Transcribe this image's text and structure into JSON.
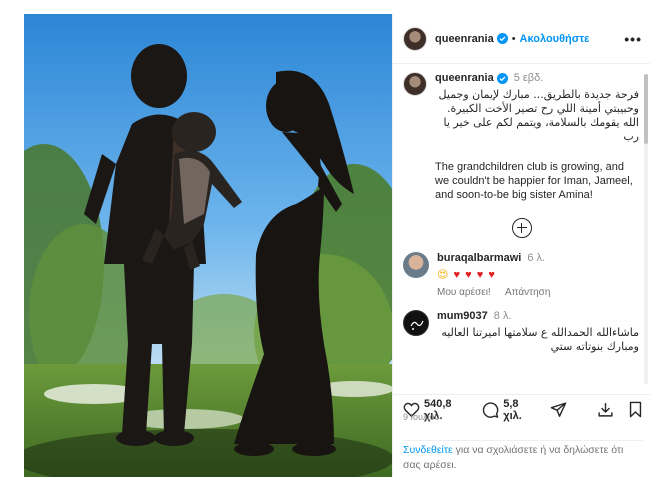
{
  "post": {
    "username": "queenrania",
    "follow_label": "Ακολουθήστε",
    "separator": "•",
    "more_label": "•••",
    "caption": {
      "username": "queenrania",
      "time": "5 εβδ.",
      "arabic_line1": "فرحة جديدة بالطريق... مبارك لإيمان وجميل",
      "arabic_line2": "وحبيبتي أمينة اللي رح تصير الأخت الكبيرة.",
      "arabic_line3": "الله يقومك بالسلامة، ويتمم لكم على خير يا",
      "arabic_line4": "رب",
      "english": "The grandchildren club is growing, and we couldn't be happier for Iman, Jameel, and soon-to-be big sister Amina!"
    },
    "comments": [
      {
        "username": "buraqalbarmawi",
        "time": "6 λ.",
        "like_label": "Μου αρέσει!",
        "reply_label": "Απάντηση"
      },
      {
        "username": "mum9037",
        "time": "8 λ.",
        "text_line1": "ماشاءالله الحمدالله ع سلامتها اميرتنا العاليه",
        "text_line2": "ومبارك بنوتاته ستي"
      }
    ],
    "likes_count": "540,8 χιλ.",
    "comments_count": "5,8 χιλ.",
    "date": "9 Ιουλίου",
    "login_link": "Συνδεθείτε",
    "login_text": " για να σχολιάσετε ή να δηλώσετε ότι σας αρέσει."
  },
  "icons": [
    "verified-badge-icon",
    "add-comment-icon",
    "heart-icon",
    "comment-icon",
    "share-icon",
    "download-icon",
    "bookmark-icon"
  ],
  "colors": {
    "link": "#0095f6",
    "verified": "#0095f6",
    "heart": "#e02020",
    "text": "#262626",
    "muted": "#8e8e8e"
  }
}
